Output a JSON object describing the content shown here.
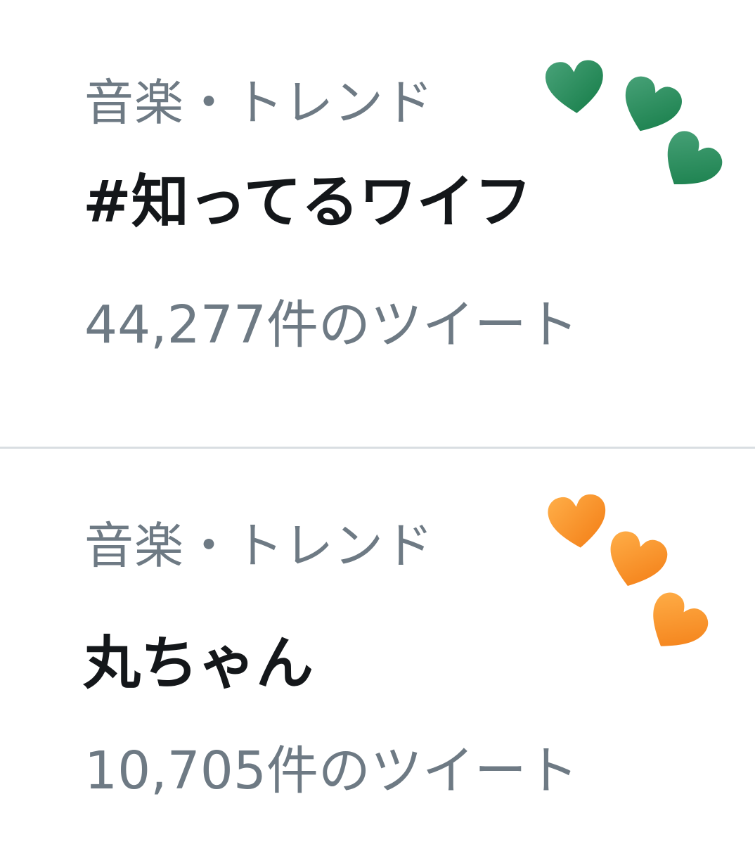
{
  "trends": [
    {
      "category": "音楽・トレンド",
      "title": "#知ってるワイフ",
      "tweet_count": "44,277件のツイート",
      "heart_color": "#1f7a4c",
      "hearts": [
        "green-heart-icon",
        "green-heart-icon",
        "green-heart-icon"
      ]
    },
    {
      "category": "音楽・トレンド",
      "title": "丸ちゃん",
      "tweet_count": "10,705件のツイート",
      "heart_color": "#f5841f",
      "hearts": [
        "orange-heart-icon",
        "orange-heart-icon",
        "orange-heart-icon"
      ]
    }
  ]
}
